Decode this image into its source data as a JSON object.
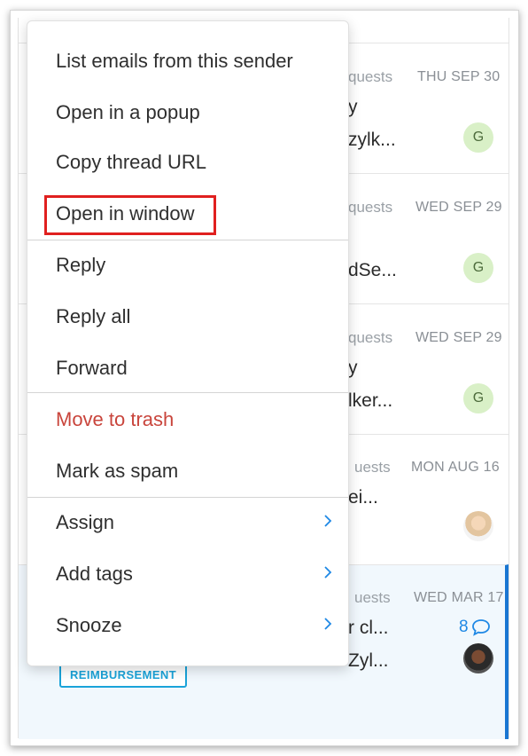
{
  "colors": {
    "accent": "#1e88e5",
    "danger": "#c9453c",
    "highlight": "#e0201f",
    "tag": "#1aa3d9",
    "selected_bg": "#f1f8fd"
  },
  "emails": [
    {
      "folder": "quests",
      "date": "THU SEP 30",
      "line1": "y",
      "line2": "zylk...",
      "avatar": "G"
    },
    {
      "folder": "quests",
      "date": "WED SEP 29",
      "line1": "",
      "line2": "dSe...",
      "avatar": "G"
    },
    {
      "folder": "quests",
      "date": "WED SEP 29",
      "line1": "y",
      "line2": "lker...",
      "avatar": "G"
    },
    {
      "folder": "uests",
      "date": "MON AUG 16",
      "line1": "ei...",
      "line2": "",
      "avatar": ""
    },
    {
      "folder": "uests",
      "date": "WED MAR 17",
      "line1": "r cl...",
      "line2": "Zyl...",
      "avatar": "",
      "comment_count": "8",
      "tag": "REIMBURSEMENT"
    }
  ],
  "menu": {
    "items": [
      {
        "label": "List emails from this sender"
      },
      {
        "label": "Open in a popup"
      },
      {
        "label": "Copy thread URL"
      },
      {
        "label": "Open in window"
      },
      {
        "label": "Reply"
      },
      {
        "label": "Reply all"
      },
      {
        "label": "Forward"
      },
      {
        "label": "Move to trash"
      },
      {
        "label": "Mark as spam"
      },
      {
        "label": "Assign",
        "submenu_icon": "chevron-right-icon"
      },
      {
        "label": "Add tags",
        "submenu_icon": "chevron-right-icon"
      },
      {
        "label": "Snooze",
        "submenu_icon": "chevron-right-icon"
      }
    ]
  }
}
